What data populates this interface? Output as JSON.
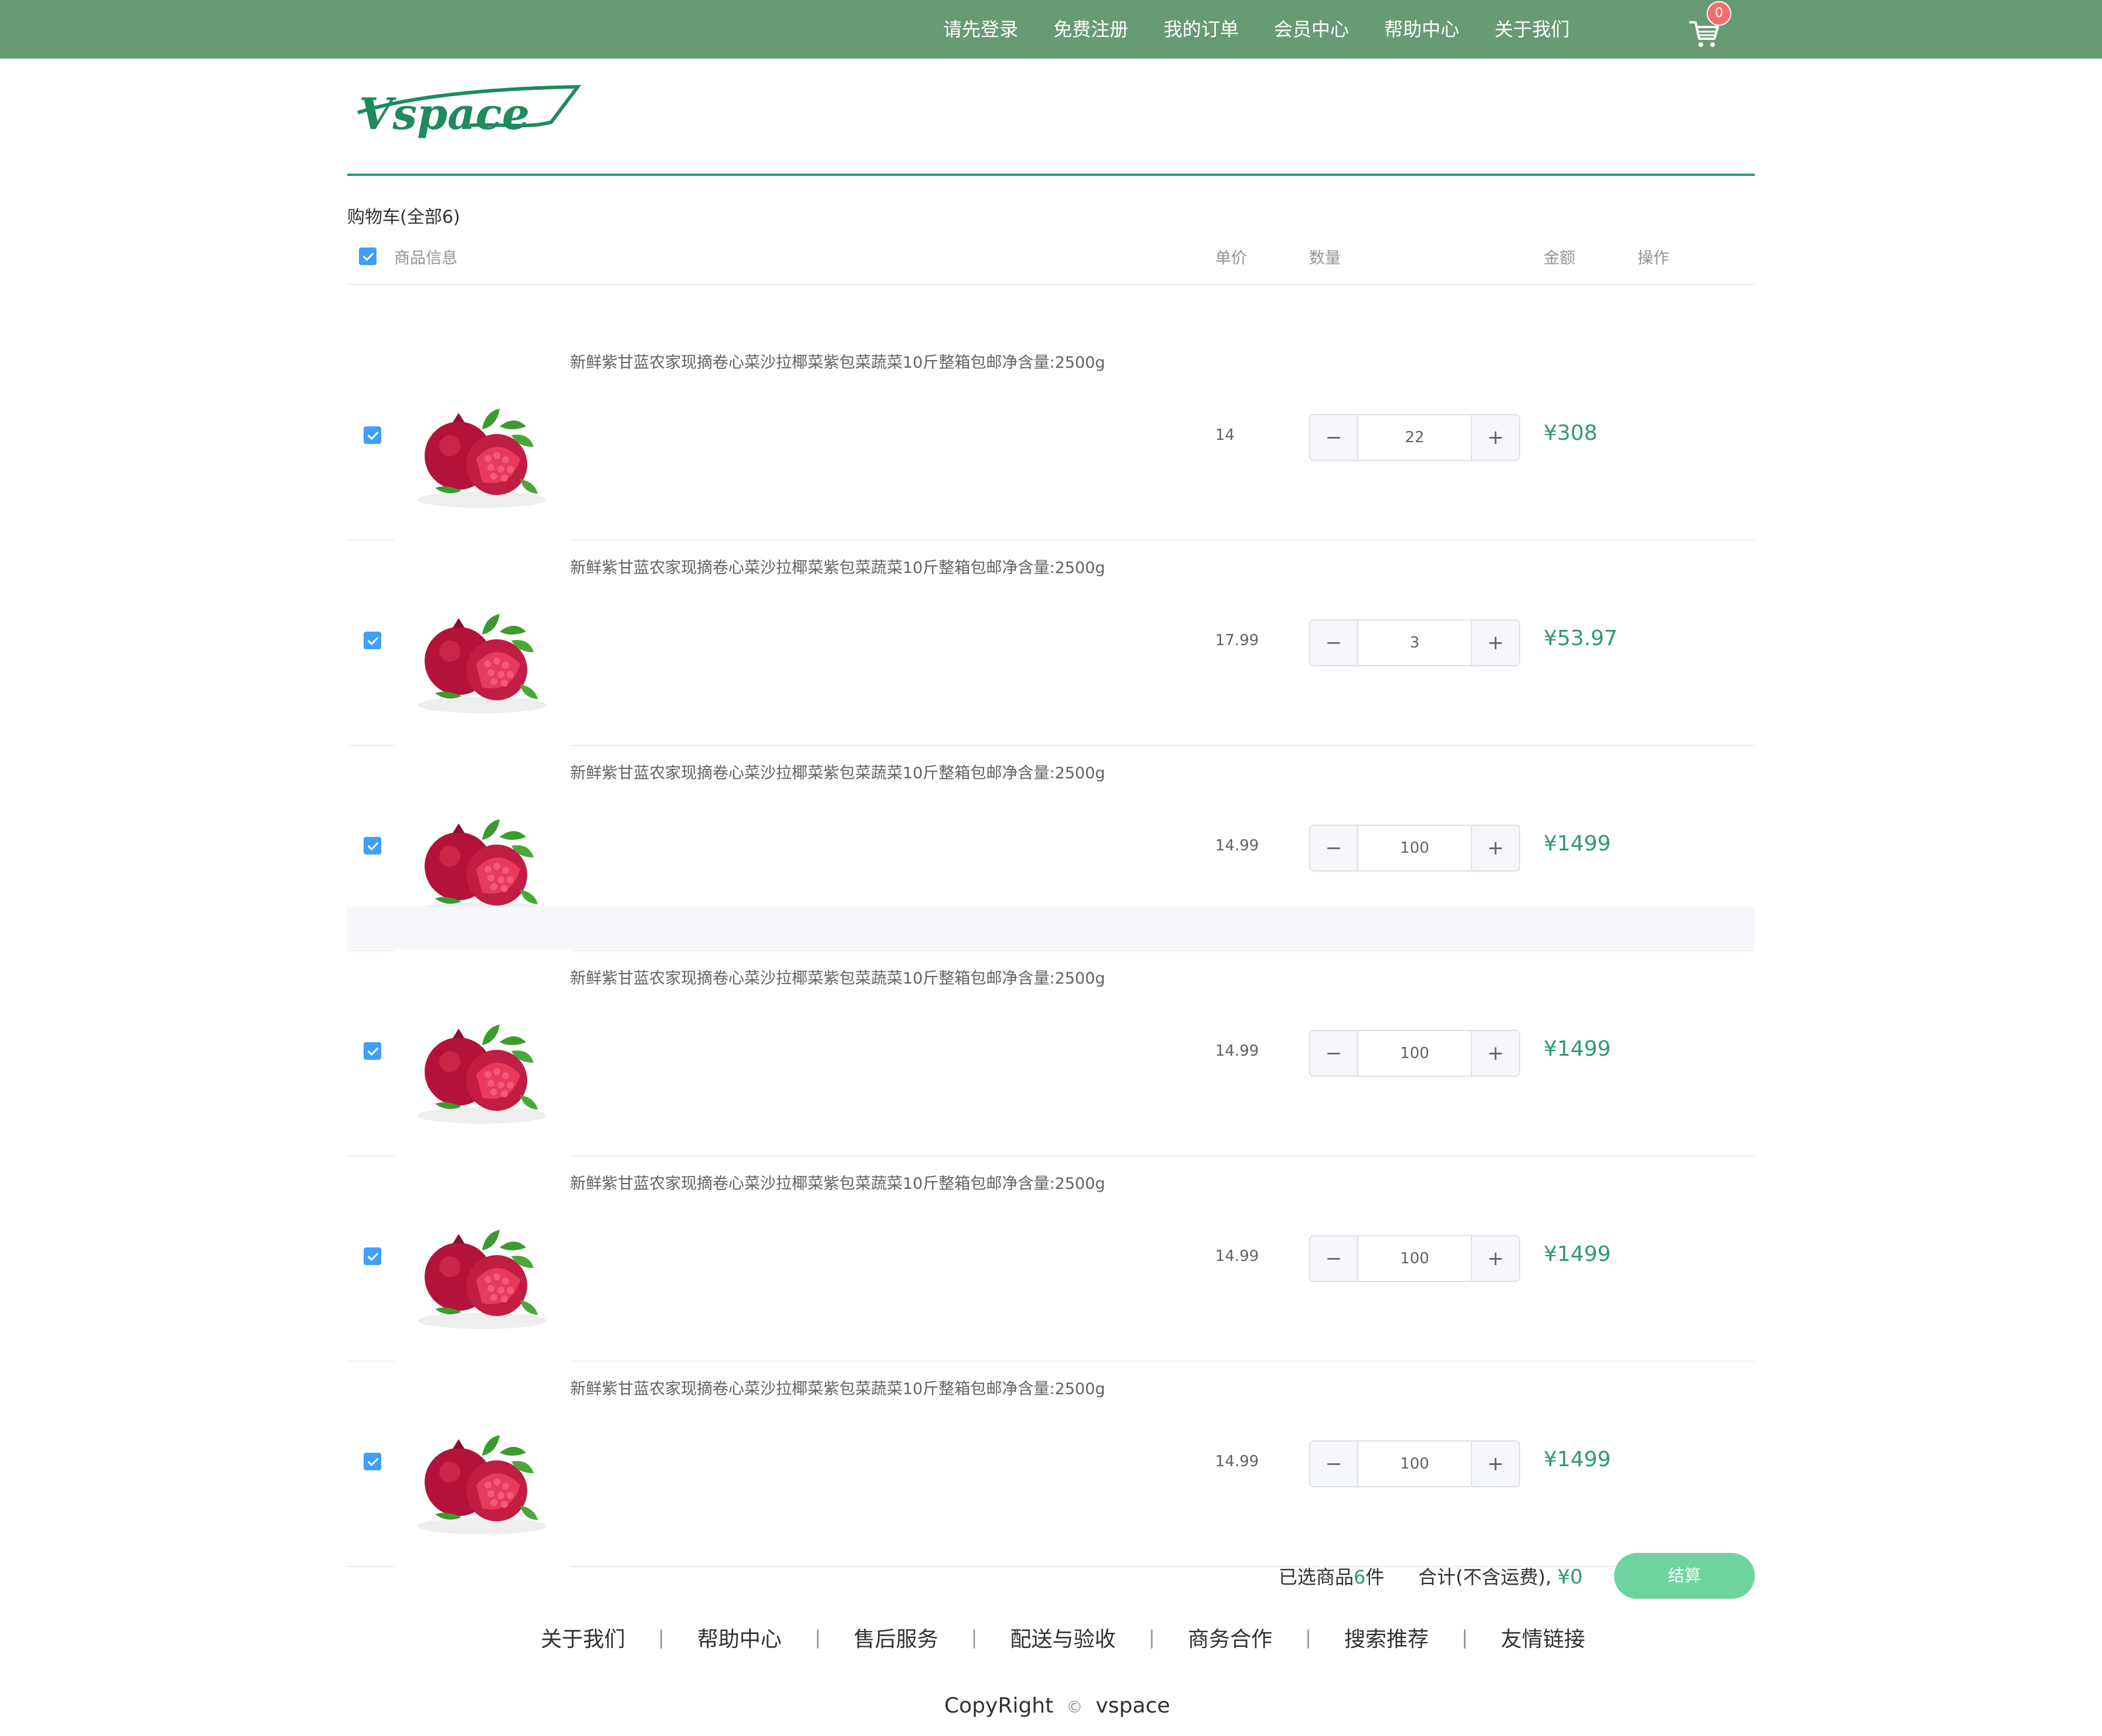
{
  "topnav": {
    "items": [
      "请先登录",
      "免费注册",
      "我的订单",
      "会员中心",
      "帮助中心",
      "关于我们"
    ],
    "cart_count": "0"
  },
  "brand": {
    "logo_text": "Vspace",
    "accent_color": "#2e9a6a",
    "topbar_color": "#679b74"
  },
  "cart": {
    "title": "购物车(全部6)",
    "headers": {
      "product": "商品信息",
      "unit_price": "单价",
      "quantity": "数量",
      "amount": "金额",
      "action": "操作"
    },
    "items": [
      {
        "name": "新鲜紫甘蓝农家现摘卷心菜沙拉椰菜紫包菜蔬菜10斤整箱包邮净含量:2500g",
        "price": "14",
        "qty": "22",
        "subtotal": "¥308",
        "image": "pomegranate"
      },
      {
        "name": "新鲜紫甘蓝农家现摘卷心菜沙拉椰菜紫包菜蔬菜10斤整箱包邮净含量:2500g",
        "price": "17.99",
        "qty": "3",
        "subtotal": "¥53.97",
        "image": "pomegranate"
      },
      {
        "name": "新鲜紫甘蓝农家现摘卷心菜沙拉椰菜紫包菜蔬菜10斤整箱包邮净含量:2500g",
        "price": "14.99",
        "qty": "100",
        "subtotal": "¥1499",
        "image": "pomegranate"
      },
      {
        "name": "新鲜紫甘蓝农家现摘卷心菜沙拉椰菜紫包菜蔬菜10斤整箱包邮净含量:2500g",
        "price": "14.99",
        "qty": "100",
        "subtotal": "¥1499",
        "image": "pomegranate"
      },
      {
        "name": "新鲜紫甘蓝农家现摘卷心菜沙拉椰菜紫包菜蔬菜10斤整箱包邮净含量:2500g",
        "price": "14.99",
        "qty": "100",
        "subtotal": "¥1499",
        "image": "pomegranate"
      },
      {
        "name": "新鲜紫甘蓝农家现摘卷心菜沙拉椰菜紫包菜蔬菜10斤整箱包邮净含量:2500g",
        "price": "14.99",
        "qty": "100",
        "subtotal": "¥1499",
        "image": "pomegranate"
      }
    ],
    "stepper": {
      "minus": "−",
      "plus": "+"
    }
  },
  "summary": {
    "selected_prefix": "已选商品",
    "selected_count": "6",
    "selected_suffix": "件",
    "total_label": "合计(不含运费),",
    "total_value": "¥0",
    "checkout_label": "结算"
  },
  "footer": {
    "links": [
      "关于我们",
      "帮助中心",
      "售后服务",
      "配送与验收",
      "商务合作",
      "搜索推荐",
      "友情链接"
    ],
    "separator": "|",
    "copyright_left": "CopyRight",
    "copyright_symbol": "©",
    "copyright_right": "vspace"
  }
}
